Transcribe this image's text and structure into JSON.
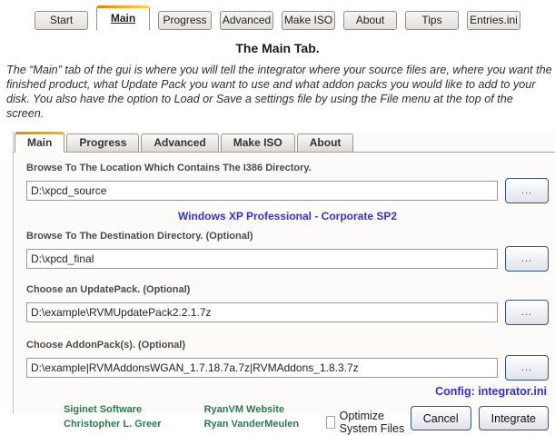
{
  "help_tabs": {
    "items": [
      {
        "label": "Start",
        "active": false
      },
      {
        "label": "Main",
        "active": true
      },
      {
        "label": "Progress",
        "active": false
      },
      {
        "label": "Advanced",
        "active": false
      },
      {
        "label": "Make ISO",
        "active": false
      },
      {
        "label": "About",
        "active": false
      },
      {
        "label": "Tips",
        "active": false
      },
      {
        "label": "Entries.ini",
        "active": false
      }
    ]
  },
  "page": {
    "title": "The Main Tab.",
    "intro": "The “Main” tab of the gui is where you will tell the integrator where your source files are, where you want the finished product, what Update Pack you want to use and what addon packs you would like to add to your disk. You also have the option to Load or Save a settings file by using the File menu at the top of the screen."
  },
  "app": {
    "tabs": [
      {
        "label": "Main",
        "active": true
      },
      {
        "label": "Progress",
        "active": false
      },
      {
        "label": "Advanced",
        "active": false
      },
      {
        "label": "Make ISO",
        "active": false
      },
      {
        "label": "About",
        "active": false
      }
    ],
    "fields": [
      {
        "label": "Browse To The Location Which Contains The I386 Directory.",
        "value": "D:\\xpcd_source",
        "browse_label": "..."
      },
      {
        "label": "Browse To The Destination Directory. (Optional)",
        "value": "D:\\xpcd_final",
        "browse_label": "..."
      },
      {
        "label": "Choose an UpdatePack. (Optional)",
        "value": "D:\\example\\RVMUpdatePack2.2.1.7z",
        "browse_label": "..."
      },
      {
        "label": "Choose AddonPack(s). (Optional)",
        "value": "D:\\example|RVMAddonsWGAN_1.7.18.7a.7z|RVMAddons_1.8.3.7z",
        "browse_label": "..."
      }
    ],
    "os_info": "Windows XP Professional -  Corporate SP2",
    "config_line": "Config: integrator.ini",
    "credits": {
      "col1": [
        "Siginet Software",
        "Christopher L. Greer"
      ],
      "col2": [
        "RyanVM Website",
        "Ryan VanderMeulen"
      ]
    },
    "optimize_label": "Optimize System Files",
    "cancel_label": "Cancel",
    "integrate_label": "Integrate"
  },
  "colors": {
    "accent_orange": "#f59b00",
    "link_blue": "#3434d6",
    "credit_green": "#2b7a4f"
  }
}
